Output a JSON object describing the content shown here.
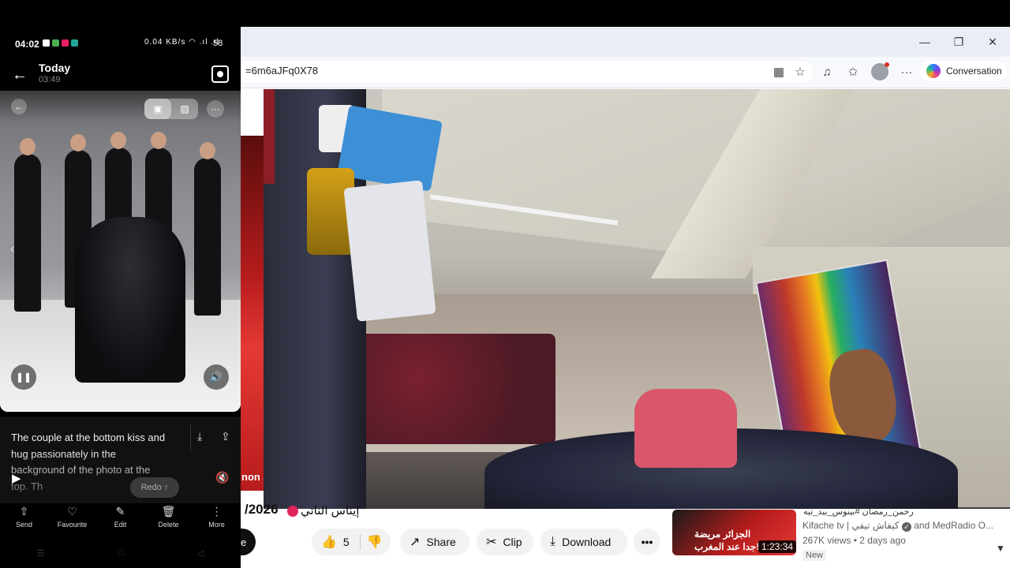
{
  "browser": {
    "address_fragment": "=6m6aJFq0X78",
    "copilot_label": "Conversation",
    "window_controls": {
      "minimize": "—",
      "restore": "❐",
      "close": "✕"
    },
    "toolbar_icons": [
      "apps-icon",
      "favorite-star-icon",
      "read-aloud-icon",
      "favorites-icon",
      "profile-icon",
      "more-icon"
    ]
  },
  "youtube": {
    "left_strip_text": "non a",
    "title_fragment": "/2026",
    "title_arabic": "إيناس الناتي",
    "subscribe_fragment": "e",
    "actions": {
      "like_count": "5",
      "share": "Share",
      "clip": "Clip",
      "download": "Download",
      "more": "•••"
    },
    "recommended": {
      "title_fragment": "رحمن_رمضان #بينوس_بيد_تيه",
      "thumb_line1": "الجزائر مريضة",
      "thumb_line2": "جدا عند المغرب!",
      "duration": "1:23:34",
      "channel": "Kifache tv | كيفاش تيفي",
      "channel_suffix": "and MedRadio O...",
      "meta": "267K views • 2 days ago",
      "badge": "New"
    }
  },
  "phone": {
    "status_time": "04:02",
    "status_right": "0.04 KB/s ◠ .ıl .ıl",
    "status_battery": "58",
    "header_title": "Today",
    "header_time": "03:49",
    "caption": "The couple at the bottom kiss and hug passionately in the background of the photo at the top. Th",
    "redo_label": "Redo",
    "toolbar": [
      {
        "name": "send",
        "icon": "⇧",
        "label": "Send"
      },
      {
        "name": "favourite",
        "icon": "♡",
        "label": "Favourite"
      },
      {
        "name": "edit",
        "icon": "✎",
        "label": "Edit"
      },
      {
        "name": "delete",
        "icon": "🗑",
        "label": "Delete"
      },
      {
        "name": "more",
        "icon": "⋮",
        "label": "More"
      }
    ],
    "status_dot_colors": [
      "#ffffff",
      "#4caf50",
      "#e91e63",
      "#26a69a"
    ]
  }
}
